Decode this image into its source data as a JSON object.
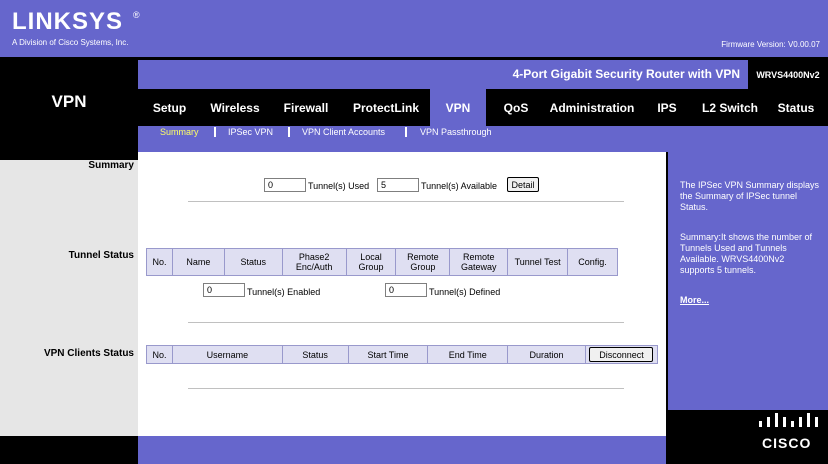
{
  "brand": {
    "logo": "LINKSYS",
    "registered": "®",
    "tagline": "A Division of Cisco Systems, Inc.",
    "firmware": "Firmware Version: V0.00.07"
  },
  "section_title": "VPN",
  "product": {
    "name": "4-Port Gigabit Security Router with VPN",
    "model": "WRVS4400Nv2"
  },
  "nav": {
    "tabs": [
      "Setup",
      "Wireless",
      "Firewall",
      "ProtectLink",
      "VPN",
      "QoS",
      "Administration",
      "IPS",
      "L2 Switch",
      "Status"
    ],
    "active": "VPN"
  },
  "subnav": {
    "items": [
      "Summary",
      "IPSec VPN",
      "VPN Client Accounts",
      "VPN Passthrough"
    ],
    "active": "Summary"
  },
  "left_labels": {
    "summary": "Summary",
    "tunnel_status": "Tunnel Status",
    "vpn_clients_status": "VPN Clients Status"
  },
  "summary": {
    "used_value": "0",
    "used_label": "Tunnel(s) Used",
    "available_value": "5",
    "available_label": "Tunnel(s) Available",
    "detail_button": "Detail"
  },
  "tunnel_table": {
    "headers": [
      "No.",
      "Name",
      "Status",
      "Phase2 Enc/Auth",
      "Local Group",
      "Remote Group",
      "Remote Gateway",
      "Tunnel Test",
      "Config."
    ],
    "enabled_value": "0",
    "enabled_label": "Tunnel(s) Enabled",
    "defined_value": "0",
    "defined_label": "Tunnel(s) Defined"
  },
  "clients_table": {
    "headers": [
      "No.",
      "Username",
      "Status",
      "Start Time",
      "End Time",
      "Duration"
    ],
    "disconnect_button": "Disconnect"
  },
  "help": {
    "p1": "The IPSec VPN Summary displays the Summary of IPSec tunnel Status.",
    "p2": "Summary:It shows the number of Tunnels Used and Tunnels Available. WRVS4400Nv2 supports 5 tunnels.",
    "more": "More..."
  },
  "cisco": "CISCO",
  "colors": {
    "brand_purple": "#6666cc",
    "black": "#000000",
    "subnav_active": "#ffff66",
    "table_header": "#dfdff2"
  }
}
